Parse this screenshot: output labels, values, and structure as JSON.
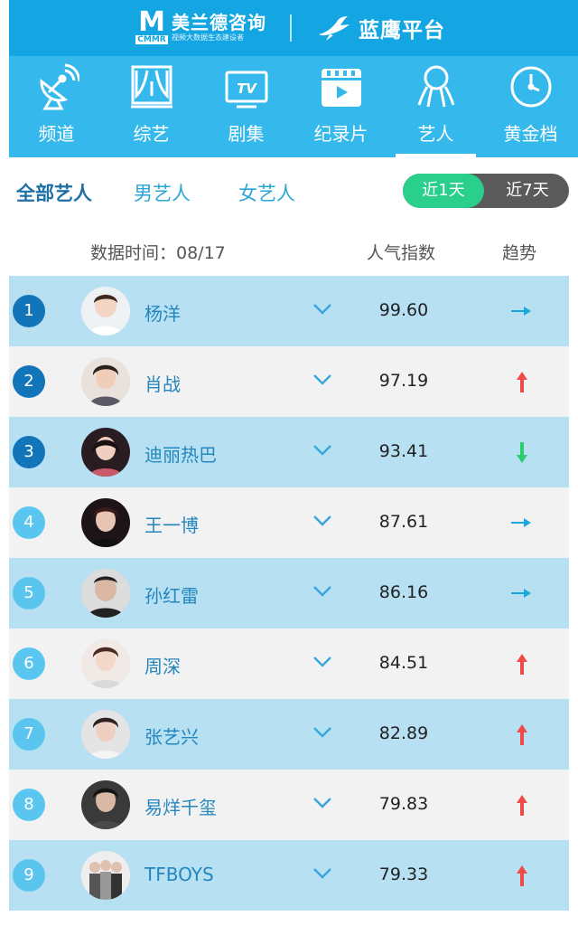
{
  "header": {
    "brand_cn": "美兰德咨询",
    "brand_logo_letters": "CMMR",
    "brand_tagline": "视频大数据生态建设者",
    "platform_name": "蓝鹰平台"
  },
  "nav": {
    "items": [
      {
        "label": "频道",
        "icon": "satellite-dish-icon"
      },
      {
        "label": "综艺",
        "icon": "stage-curtain-icon"
      },
      {
        "label": "剧集",
        "icon": "tv-icon"
      },
      {
        "label": "纪录片",
        "icon": "film-clapper-icon"
      },
      {
        "label": "艺人",
        "icon": "artist-icon",
        "active": true
      },
      {
        "label": "黄金档",
        "icon": "clock-icon"
      }
    ],
    "tv_text": "TV"
  },
  "filters": {
    "tabs": [
      "全部艺人",
      "男艺人",
      "女艺人"
    ],
    "active_tab": "全部艺人",
    "range_options": [
      "近1天",
      "近7天"
    ],
    "active_range": "近1天"
  },
  "table": {
    "date_label": "数据时间：08/17",
    "popularity_header": "人气指数",
    "trend_header": "趋势",
    "rows": [
      {
        "rank": "1",
        "name": "杨洋",
        "score": "99.60",
        "trend": "flat"
      },
      {
        "rank": "2",
        "name": "肖战",
        "score": "97.19",
        "trend": "up"
      },
      {
        "rank": "3",
        "name": "迪丽热巴",
        "score": "93.41",
        "trend": "down"
      },
      {
        "rank": "4",
        "name": "王一博",
        "score": "87.61",
        "trend": "flat"
      },
      {
        "rank": "5",
        "name": "孙红雷",
        "score": "86.16",
        "trend": "flat"
      },
      {
        "rank": "6",
        "name": "周深",
        "score": "84.51",
        "trend": "up"
      },
      {
        "rank": "7",
        "name": "张艺兴",
        "score": "82.89",
        "trend": "up"
      },
      {
        "rank": "8",
        "name": "易烊千玺",
        "score": "79.83",
        "trend": "up"
      },
      {
        "rank": "9",
        "name": "TFBOYS",
        "score": "79.33",
        "trend": "up"
      }
    ]
  },
  "colors": {
    "header_blue": "#14a6e3",
    "nav_blue": "#35b8ec",
    "row_blue": "#b7e0f3",
    "row_grey": "#f2f2f2",
    "trend_flat": "#1aa6e0",
    "trend_up": "#ef4a4a",
    "trend_down": "#2ecc71",
    "toggle_on": "#29cf8b"
  }
}
